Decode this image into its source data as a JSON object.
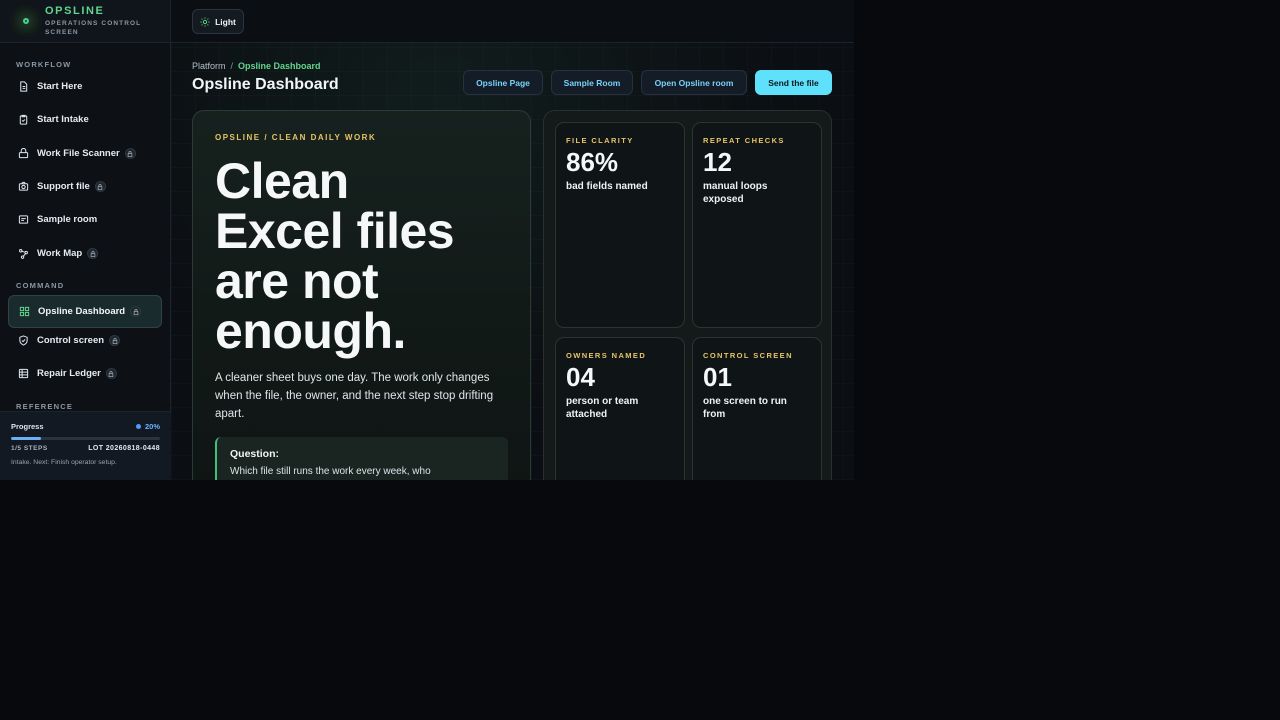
{
  "brand": {
    "name": "OPSLINE",
    "subtitle": "OPERATIONS CONTROL SCREEN"
  },
  "sidebar": {
    "sections": [
      {
        "label": "WORKFLOW"
      },
      {
        "label": "COMMAND"
      },
      {
        "label": "REFERENCE"
      }
    ],
    "items": [
      {
        "label": "Start Here",
        "icon": "document-icon",
        "locked": false
      },
      {
        "label": "Start Intake",
        "icon": "clipboard-icon",
        "locked": false
      },
      {
        "label": "Work File Scanner",
        "icon": "scanner-icon",
        "locked": true
      },
      {
        "label": "Support file",
        "icon": "camera-icon",
        "locked": true
      },
      {
        "label": "Sample room",
        "icon": "message-icon",
        "locked": false
      },
      {
        "label": "Work Map",
        "icon": "map-icon",
        "locked": true
      },
      {
        "label": "Opsline Dashboard",
        "icon": "dashboard-icon",
        "locked": true,
        "active": true
      },
      {
        "label": "Control screen",
        "icon": "shield-icon",
        "locked": true
      },
      {
        "label": "Repair Ledger",
        "icon": "ledger-icon",
        "locked": true
      }
    ]
  },
  "progress": {
    "label": "Progress",
    "percent_label": "20%",
    "fraction": 0.2,
    "steps": "1/5 STEPS",
    "lot": "LOT 20260818-0448",
    "note": "Intake. Next: Finish operator setup."
  },
  "topbar": {
    "theme_label": "Light"
  },
  "breadcrumb": {
    "root": "Platform",
    "separator": "/",
    "current": "Opsline Dashboard"
  },
  "page_title": "Opsline Dashboard",
  "actions": [
    {
      "label": "Opsline Page"
    },
    {
      "label": "Sample Room"
    },
    {
      "label": "Open Opsline room"
    },
    {
      "label": "Send the file",
      "primary": true
    }
  ],
  "hero": {
    "eyebrow": "OPSLINE / CLEAN DAILY WORK",
    "headline_lines": [
      "Clean",
      "Excel files",
      "are not",
      "enough."
    ],
    "body": "A cleaner sheet buys one day. The work only changes when the file, the owner, and the next step stop drifting apart.",
    "question_title": "Question:",
    "question_body": "Which file still runs the work every week, who"
  },
  "stats": [
    {
      "label": "FILE CLARITY",
      "value": "86%",
      "desc": "bad fields named"
    },
    {
      "label": "REPEAT CHECKS",
      "value": "12",
      "desc": "manual loops exposed"
    },
    {
      "label": "OWNERS NAMED",
      "value": "04",
      "desc": "person or team attached"
    },
    {
      "label": "CONTROL SCREEN",
      "value": "01",
      "desc": "one screen to run from"
    }
  ],
  "colors": {
    "accent_green": "#5fd58c",
    "accent_cyan": "#5fe0fb",
    "eyebrow_gold": "#e6c36a",
    "progress_blue": "#6cb0f4"
  }
}
